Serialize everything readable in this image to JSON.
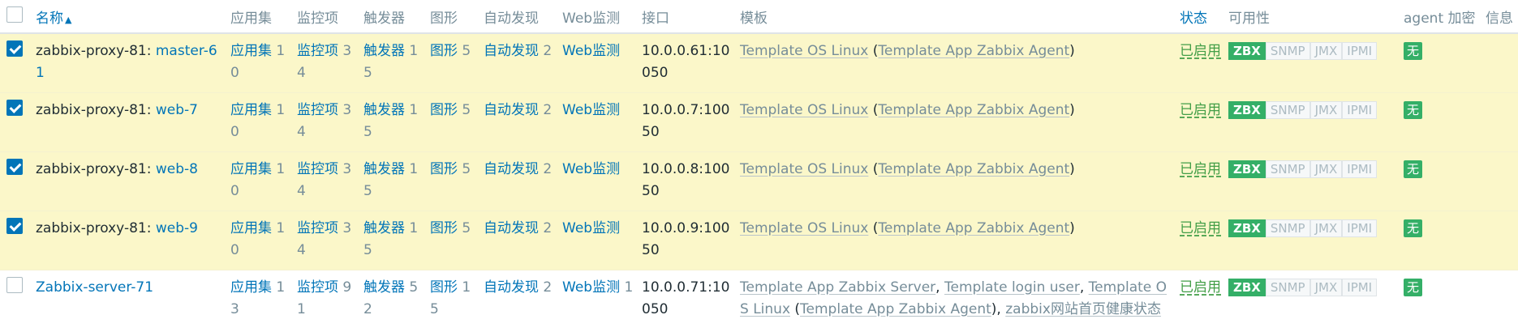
{
  "headers": {
    "name": "名称",
    "applications": "应用集",
    "items": "监控项",
    "triggers": "触发器",
    "graphs": "图形",
    "discovery": "自动发现",
    "web": "Web监测",
    "interface": "接口",
    "templates": "模板",
    "status": "状态",
    "availability": "可用性",
    "encryption": "agent 加密",
    "info": "信息"
  },
  "badges": {
    "zbx": "ZBX",
    "snmp": "SNMP",
    "jmx": "JMX",
    "ipmi": "IPMI"
  },
  "rows": [
    {
      "checked": true,
      "proxy": "zabbix-proxy-81: ",
      "name": "master-61",
      "app_label": "应用集",
      "app_count": "10",
      "items_label": "监控项",
      "items_count": "34",
      "triggers_label": "触发器",
      "triggers_count": "15",
      "graphs_label": "图形",
      "graphs_count": "5",
      "discovery_label": "自动发现",
      "discovery_count": "2",
      "web_label": "Web监测",
      "web_count": "",
      "interface": "10.0.0.61:10050",
      "template_main": "Template OS Linux",
      "template_sub": "Template App Zabbix Agent",
      "status": "已启用",
      "encryption": "无"
    },
    {
      "checked": true,
      "proxy": "zabbix-proxy-81: ",
      "name": "web-7",
      "app_label": "应用集",
      "app_count": "10",
      "items_label": "监控项",
      "items_count": "34",
      "triggers_label": "触发器",
      "triggers_count": "15",
      "graphs_label": "图形",
      "graphs_count": "5",
      "discovery_label": "自动发现",
      "discovery_count": "2",
      "web_label": "Web监测",
      "web_count": "",
      "interface": "10.0.0.7:10050",
      "template_main": "Template OS Linux",
      "template_sub": "Template App Zabbix Agent",
      "status": "已启用",
      "encryption": "无"
    },
    {
      "checked": true,
      "proxy": "zabbix-proxy-81: ",
      "name": "web-8",
      "app_label": "应用集",
      "app_count": "10",
      "items_label": "监控项",
      "items_count": "34",
      "triggers_label": "触发器",
      "triggers_count": "15",
      "graphs_label": "图形",
      "graphs_count": "5",
      "discovery_label": "自动发现",
      "discovery_count": "2",
      "web_label": "Web监测",
      "web_count": "",
      "interface": "10.0.0.8:10050",
      "template_main": "Template OS Linux",
      "template_sub": "Template App Zabbix Agent",
      "status": "已启用",
      "encryption": "无"
    },
    {
      "checked": true,
      "proxy": "zabbix-proxy-81: ",
      "name": "web-9",
      "app_label": "应用集",
      "app_count": "10",
      "items_label": "监控项",
      "items_count": "34",
      "triggers_label": "触发器",
      "triggers_count": "15",
      "graphs_label": "图形",
      "graphs_count": "5",
      "discovery_label": "自动发现",
      "discovery_count": "2",
      "web_label": "Web监测",
      "web_count": "",
      "interface": "10.0.0.9:10050",
      "template_main": "Template OS Linux",
      "template_sub": "Template App Zabbix Agent",
      "status": "已启用",
      "encryption": "无"
    }
  ],
  "last_row": {
    "checked": false,
    "name": "Zabbix-server-71",
    "app_label": "应用集",
    "app_count": "13",
    "items_label": "监控项",
    "items_count": "91",
    "triggers_label": "触发器",
    "triggers_count": "52",
    "graphs_label": "图形",
    "graphs_count": "15",
    "discovery_label": "自动发现",
    "discovery_count": "2",
    "web_label": "Web监测",
    "web_count": "1",
    "interface": "10.0.0.71:10050",
    "templates": [
      {
        "name": "Template App Zabbix Server",
        "sep": ", "
      },
      {
        "name": "Template login user",
        "sep": ", "
      },
      {
        "name": "Template OS Linux",
        "sep": " ("
      },
      {
        "name": "Template App Zabbix Agent",
        "sep": "), "
      },
      {
        "name": "zabbix网站首页健康状态",
        "sep": ""
      }
    ],
    "status": "已启用",
    "encryption": "无"
  }
}
